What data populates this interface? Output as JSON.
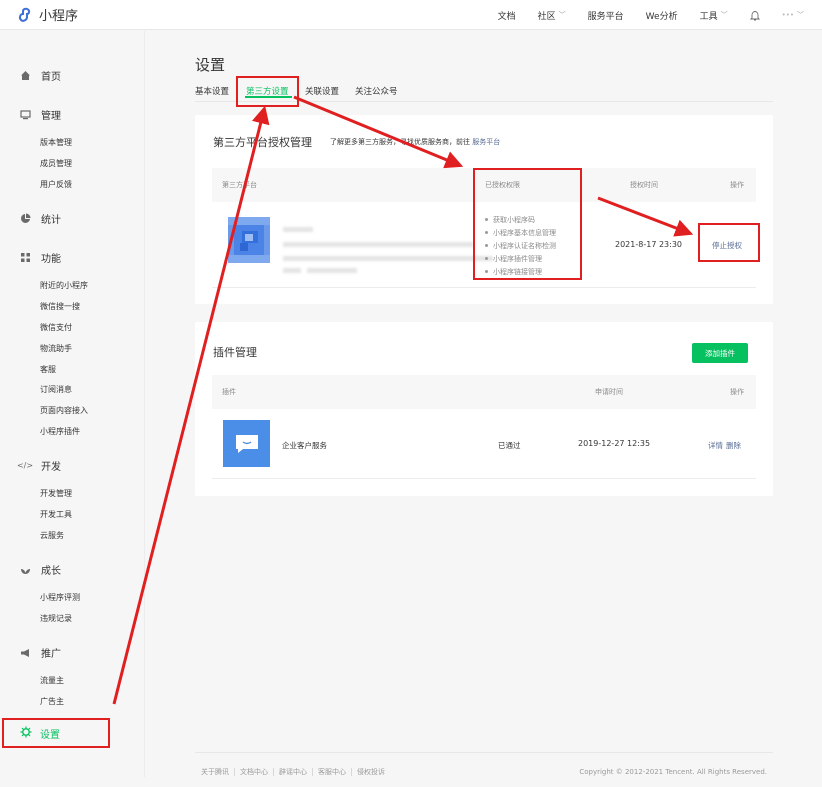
{
  "app": {
    "title": "小程序"
  },
  "topnav": {
    "items": [
      "文档",
      "社区",
      "服务平台",
      "We分析",
      "工具"
    ],
    "avatar_text": "•••"
  },
  "sidebar": {
    "home": "首页",
    "manage": {
      "label": "管理",
      "items": [
        "版本管理",
        "成员管理",
        "用户反馈"
      ]
    },
    "stats": "统计",
    "features": {
      "label": "功能",
      "items": [
        "附近的小程序",
        "微信搜一搜",
        "微信支付",
        "物流助手",
        "客服",
        "订阅消息",
        "页面内容接入",
        "小程序插件"
      ]
    },
    "dev": {
      "label": "开发",
      "items": [
        "开发管理",
        "开发工具",
        "云服务"
      ]
    },
    "growth": {
      "label": "成长",
      "items": [
        "小程序评测",
        "违规记录"
      ]
    },
    "promo": {
      "label": "推广",
      "items": [
        "流量主",
        "广告主"
      ]
    },
    "settings": "设置"
  },
  "page": {
    "title": "设置",
    "tabs": [
      "基本设置",
      "第三方设置",
      "关联设置",
      "关注公众号"
    ],
    "active_tab": 1
  },
  "third_party": {
    "title": "第三方平台授权管理",
    "desc": "了解更多第三方服务，寻找优质服务商，前往",
    "desc_link": "服务平台",
    "columns": [
      "第三方平台",
      "已授权权限",
      "授权时间",
      "操作"
    ],
    "permissions": [
      "获取小程序码",
      "小程序基本信息管理",
      "小程序认证名称检测",
      "小程序插件管理",
      "小程序链接管理"
    ],
    "auth_time": "2021-8-17 23:30",
    "stop_label": "停止授权"
  },
  "plugins": {
    "title": "插件管理",
    "add_label": "添加插件",
    "columns": [
      "插件",
      "申请时间",
      "操作"
    ],
    "row": {
      "name": "企业客户服务",
      "status": "已通过",
      "time": "2019-12-27 12:35",
      "detail": "详情",
      "delete": "删除"
    }
  },
  "footer": {
    "links": [
      "关于腾讯",
      "文档中心",
      "辟谣中心",
      "客服中心",
      "侵权投诉"
    ],
    "copyright": "Copyright © 2012-2021 Tencent. All Rights Reserved."
  },
  "colors": {
    "accent": "#07c160",
    "link": "#576b95",
    "annotation": "#e02020"
  }
}
